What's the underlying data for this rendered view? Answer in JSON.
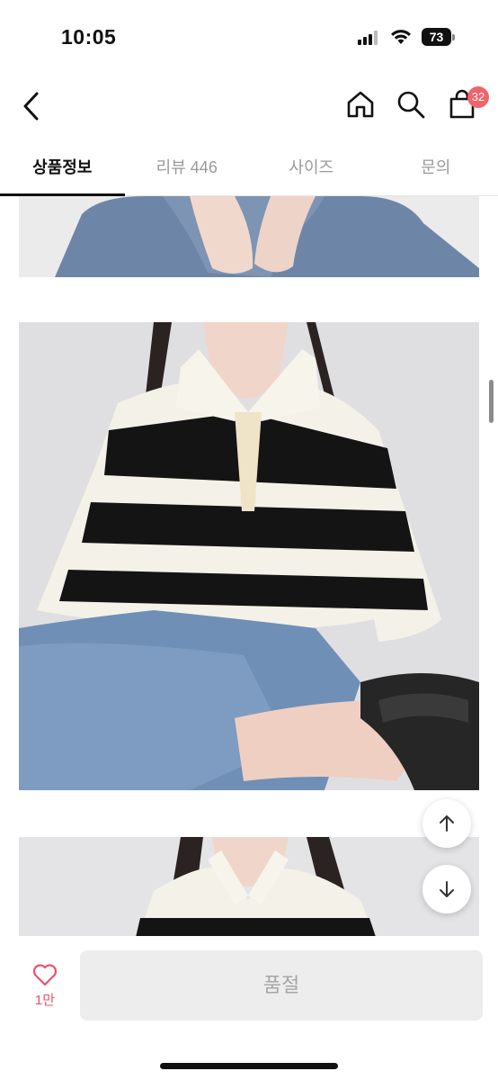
{
  "status_bar": {
    "time": "10:05",
    "battery": "73"
  },
  "header": {
    "back_icon": "chevron-left-icon",
    "home_icon": "home-icon",
    "search_icon": "search-icon",
    "cart_icon": "shopping-bag-icon",
    "cart_badge": "32",
    "badge_color": "#f2636b"
  },
  "tabs": [
    {
      "label": "상품정보",
      "active": true
    },
    {
      "label": "리뷰 446",
      "active": false
    },
    {
      "label": "사이즈",
      "active": false
    },
    {
      "label": "문의",
      "active": false
    }
  ],
  "floating": {
    "scroll_up_icon": "arrow-up-icon",
    "scroll_down_icon": "arrow-down-icon"
  },
  "bottom_bar": {
    "like_icon": "heart-icon",
    "like_count": "1만",
    "like_color": "#e9536b",
    "button_label": "품절"
  }
}
